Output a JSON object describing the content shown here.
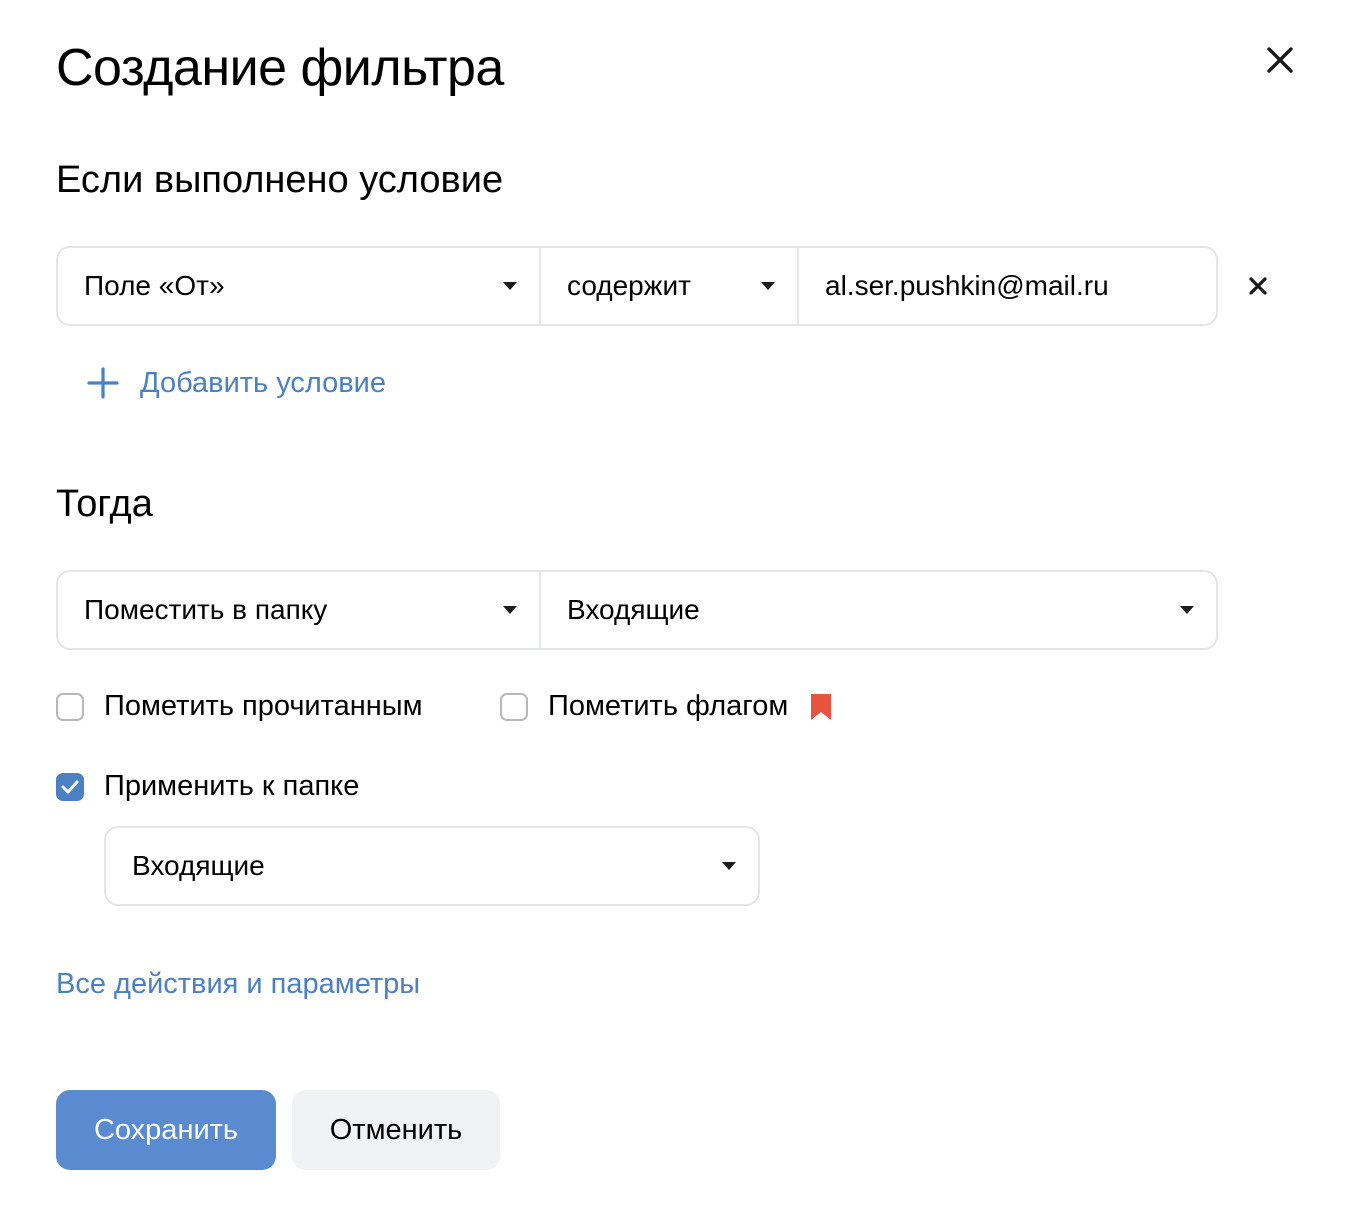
{
  "dialog": {
    "title": "Создание фильтра"
  },
  "condition": {
    "heading": "Если выполнено условие",
    "field_label": "Поле «От»",
    "operator_label": "содержит",
    "value": "al.ser.pushkin@mail.ru",
    "add_label": "Добавить условие"
  },
  "action": {
    "heading": "Тогда",
    "type_label": "Поместить в папку",
    "folder_label": "Входящие",
    "mark_read_label": "Пометить прочитанным",
    "mark_read_checked": false,
    "flag_label": "Пометить флагом",
    "flag_checked": false,
    "flag_color": "#e8533f",
    "apply_label": "Применить к папке",
    "apply_checked": true,
    "apply_folder_label": "Входящие",
    "all_actions_link": "Все действия и параметры"
  },
  "buttons": {
    "save_label": "Сохранить",
    "cancel_label": "Отменить"
  },
  "colors": {
    "accent": "#4c80c3",
    "primary_button": "#5a8bd0",
    "secondary_button": "#f1f2f4",
    "border": "#e4e5e7"
  }
}
